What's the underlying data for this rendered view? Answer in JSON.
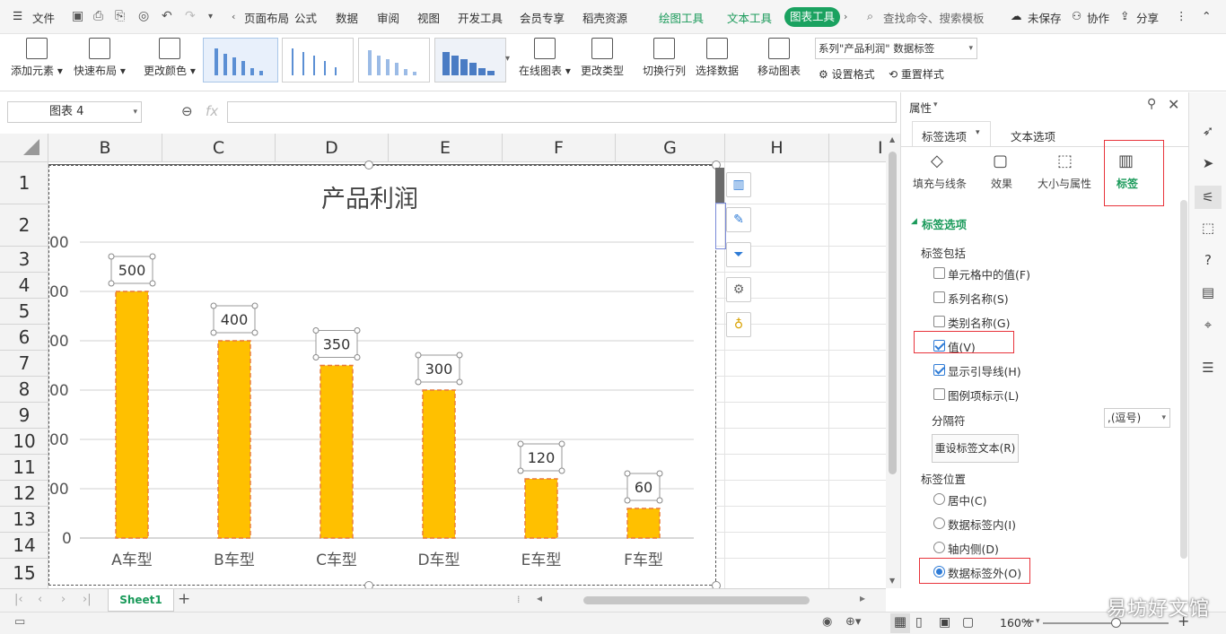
{
  "menubar": {
    "file": "文件",
    "items": [
      "页面布局",
      "公式",
      "数据",
      "审阅",
      "视图",
      "开发工具",
      "会员专享",
      "稻壳资源"
    ],
    "context_tabs": [
      "绘图工具",
      "文本工具"
    ],
    "active_tab": "图表工具",
    "search_placeholder": "查找命令、搜索模板",
    "unsaved": "未保存",
    "collab": "协作",
    "share": "分享"
  },
  "ribbon": {
    "add_element": "添加元素",
    "quick_layout": "快速布局",
    "change_color": "更改颜色",
    "online_chart": "在线图表",
    "change_type": "更改类型",
    "switch_rowcol": "切换行列",
    "select_data": "选择数据",
    "move_chart": "移动图表",
    "series_selector": "系列\"产品利润\" 数据标签",
    "set_format": "设置格式",
    "reset_style": "重置样式"
  },
  "formula": {
    "name_box": "图表 4",
    "fx": "fx"
  },
  "sheet": {
    "columns": [
      "B",
      "C",
      "D",
      "E",
      "F",
      "G",
      "H",
      "I"
    ],
    "rows": [
      "1",
      "2",
      "3",
      "4",
      "5",
      "6",
      "7",
      "8",
      "9",
      "10",
      "11",
      "12",
      "13",
      "14",
      "15"
    ],
    "tab": "Sheet1"
  },
  "chart_data": {
    "type": "bar",
    "title": "产品利润",
    "categories": [
      "A车型",
      "B车型",
      "C车型",
      "D车型",
      "E车型",
      "F车型"
    ],
    "values": [
      500,
      400,
      350,
      300,
      120,
      60
    ],
    "data_labels": [
      "500",
      "400",
      "350",
      "300",
      "120",
      "60"
    ],
    "ytick_labels": [
      "00",
      "00",
      "00",
      "00",
      "00",
      "00",
      "0"
    ],
    "ylim": [
      0,
      600
    ],
    "grid": true,
    "bar_color": "#ffc000",
    "bar_border_color": "#e8793a"
  },
  "panel": {
    "title": "属性",
    "tab_label_options": "标签选项",
    "tab_text_options": "文本选项",
    "sub_fill": "填充与线条",
    "sub_effect": "效果",
    "sub_size": "大小与属性",
    "sub_label": "标签",
    "section": "标签选项",
    "label_contains": "标签包括",
    "opt_cell_value": "单元格中的值(F)",
    "opt_series_name": "系列名称(S)",
    "opt_category_name": "类别名称(G)",
    "opt_value": "值(V)",
    "opt_leader_lines": "显示引导线(H)",
    "opt_legend_key": "图例项标示(L)",
    "separator": "分隔符",
    "separator_value": ",(逗号)",
    "reset_text": "重设标签文本(R)",
    "label_position": "标签位置",
    "pos_center": "居中(C)",
    "pos_inside_end": "数据标签内(I)",
    "pos_inside_base": "轴内侧(D)",
    "pos_outside_end": "数据标签外(O)"
  },
  "status": {
    "zoom": "160%",
    "watermark": "易坊好文馆"
  }
}
